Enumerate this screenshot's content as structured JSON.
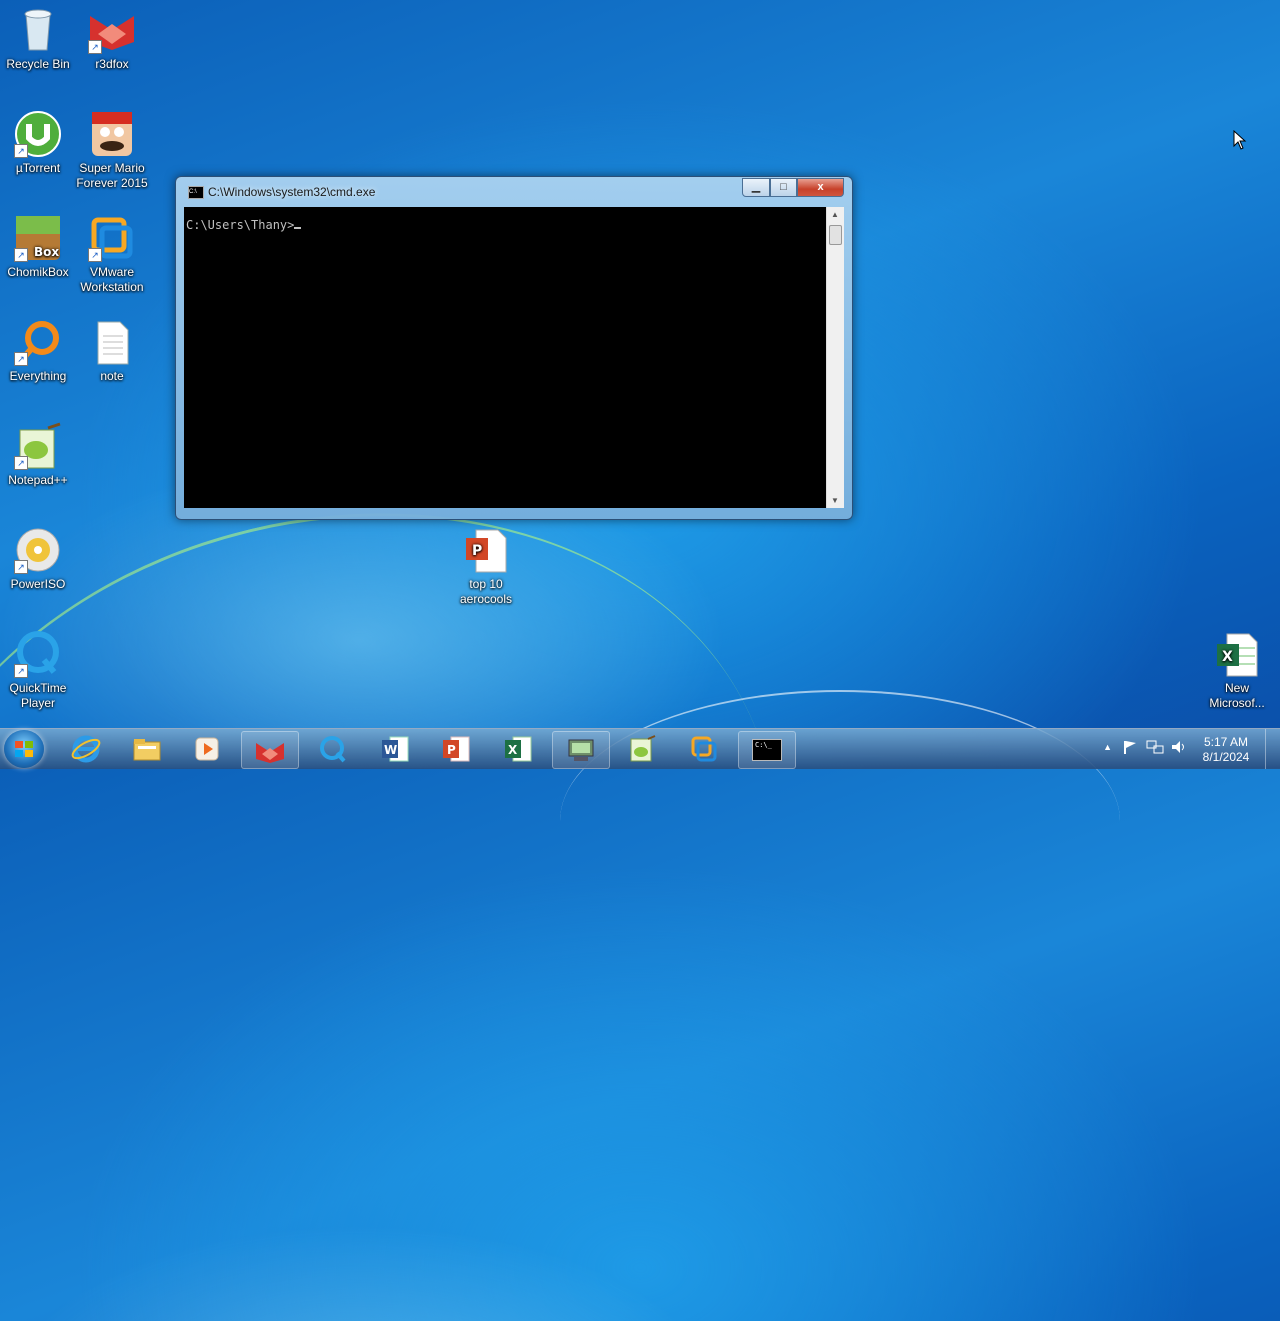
{
  "desktop": {
    "icons": [
      {
        "label": "Recycle Bin"
      },
      {
        "label": "r3dfox"
      },
      {
        "label": "µTorrent"
      },
      {
        "label": "Super Mario Forever 2015"
      },
      {
        "label": "ChomikBox"
      },
      {
        "label": "VMware Workstation"
      },
      {
        "label": "Everything"
      },
      {
        "label": "note"
      },
      {
        "label": "Notepad++"
      },
      {
        "label": "PowerISO"
      },
      {
        "label": "QuickTime Player"
      },
      {
        "label": "top 10 aerocools"
      },
      {
        "label": "New Microsof..."
      }
    ]
  },
  "cmd_window": {
    "title": "C:\\Windows\\system32\\cmd.exe",
    "icon_text": "C:\\",
    "prompt": "C:\\Users\\Thany>",
    "minimize": "▁",
    "maximize": "□",
    "close": "x"
  },
  "taskbar": {
    "apps": [
      {
        "icon": "internet-explorer-icon"
      },
      {
        "icon": "file-explorer-icon"
      },
      {
        "icon": "media-player-icon"
      },
      {
        "icon": "r3dfox-icon"
      },
      {
        "icon": "quicktime-icon"
      },
      {
        "icon": "word-icon"
      },
      {
        "icon": "powerpoint-icon"
      },
      {
        "icon": "excel-icon"
      },
      {
        "icon": "network-app-icon"
      },
      {
        "icon": "notepad-plus-plus-icon"
      },
      {
        "icon": "vmware-icon"
      },
      {
        "icon": "cmd-icon"
      }
    ],
    "cmd_task_text": "C:\\_",
    "clock_time": "5:17 AM",
    "clock_date": "8/1/2024"
  },
  "colors": {
    "desktop_blue": "#1a86d8",
    "taskbar": "#28507f",
    "console_bg": "#000000",
    "console_fg": "#c0c0c0"
  }
}
